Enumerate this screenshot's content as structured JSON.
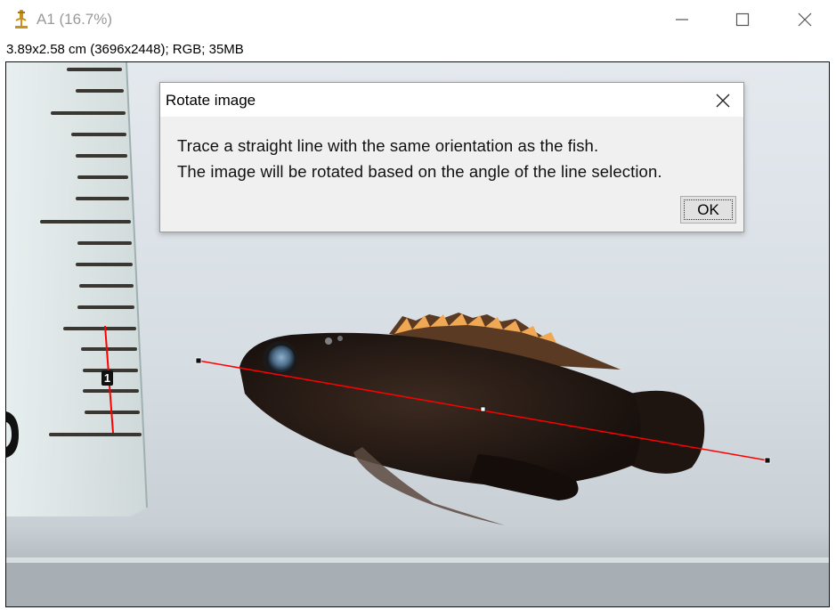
{
  "window": {
    "title": "A1 (16.7%)",
    "icon": "microscope-icon",
    "controls": [
      "minimize-icon",
      "maximize-icon",
      "close-icon"
    ]
  },
  "image_info": "3.89x2.58 cm (3696x2448); RGB; 35MB",
  "canvas": {
    "ruler_label": "1",
    "selection_color": "#ff0000"
  },
  "dialog": {
    "title": "Rotate image",
    "message_line1": "Trace a straight line with the same orientation as the fish.",
    "message_line2": "The image will be rotated based on the angle of the line selection.",
    "ok_label": "OK"
  }
}
